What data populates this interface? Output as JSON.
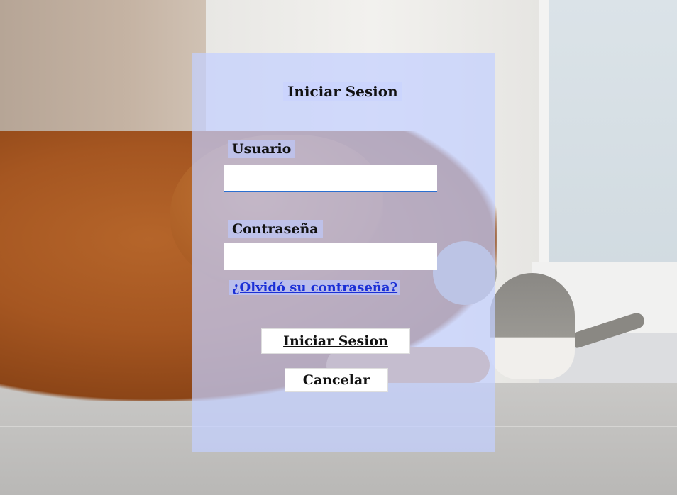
{
  "login": {
    "title": "Iniciar Sesion",
    "username_label": "Usuario",
    "username_value": "",
    "password_label": "Contraseña",
    "password_value": "",
    "forgot_password_link": "¿Olvidó su contraseña?",
    "submit_button": "Iniciar Sesion",
    "cancel_button": "Cancelar"
  },
  "colors": {
    "panel_overlay": "#c4d0ff",
    "link": "#1a2fd6",
    "input_focus_border": "#2b6fd0"
  }
}
